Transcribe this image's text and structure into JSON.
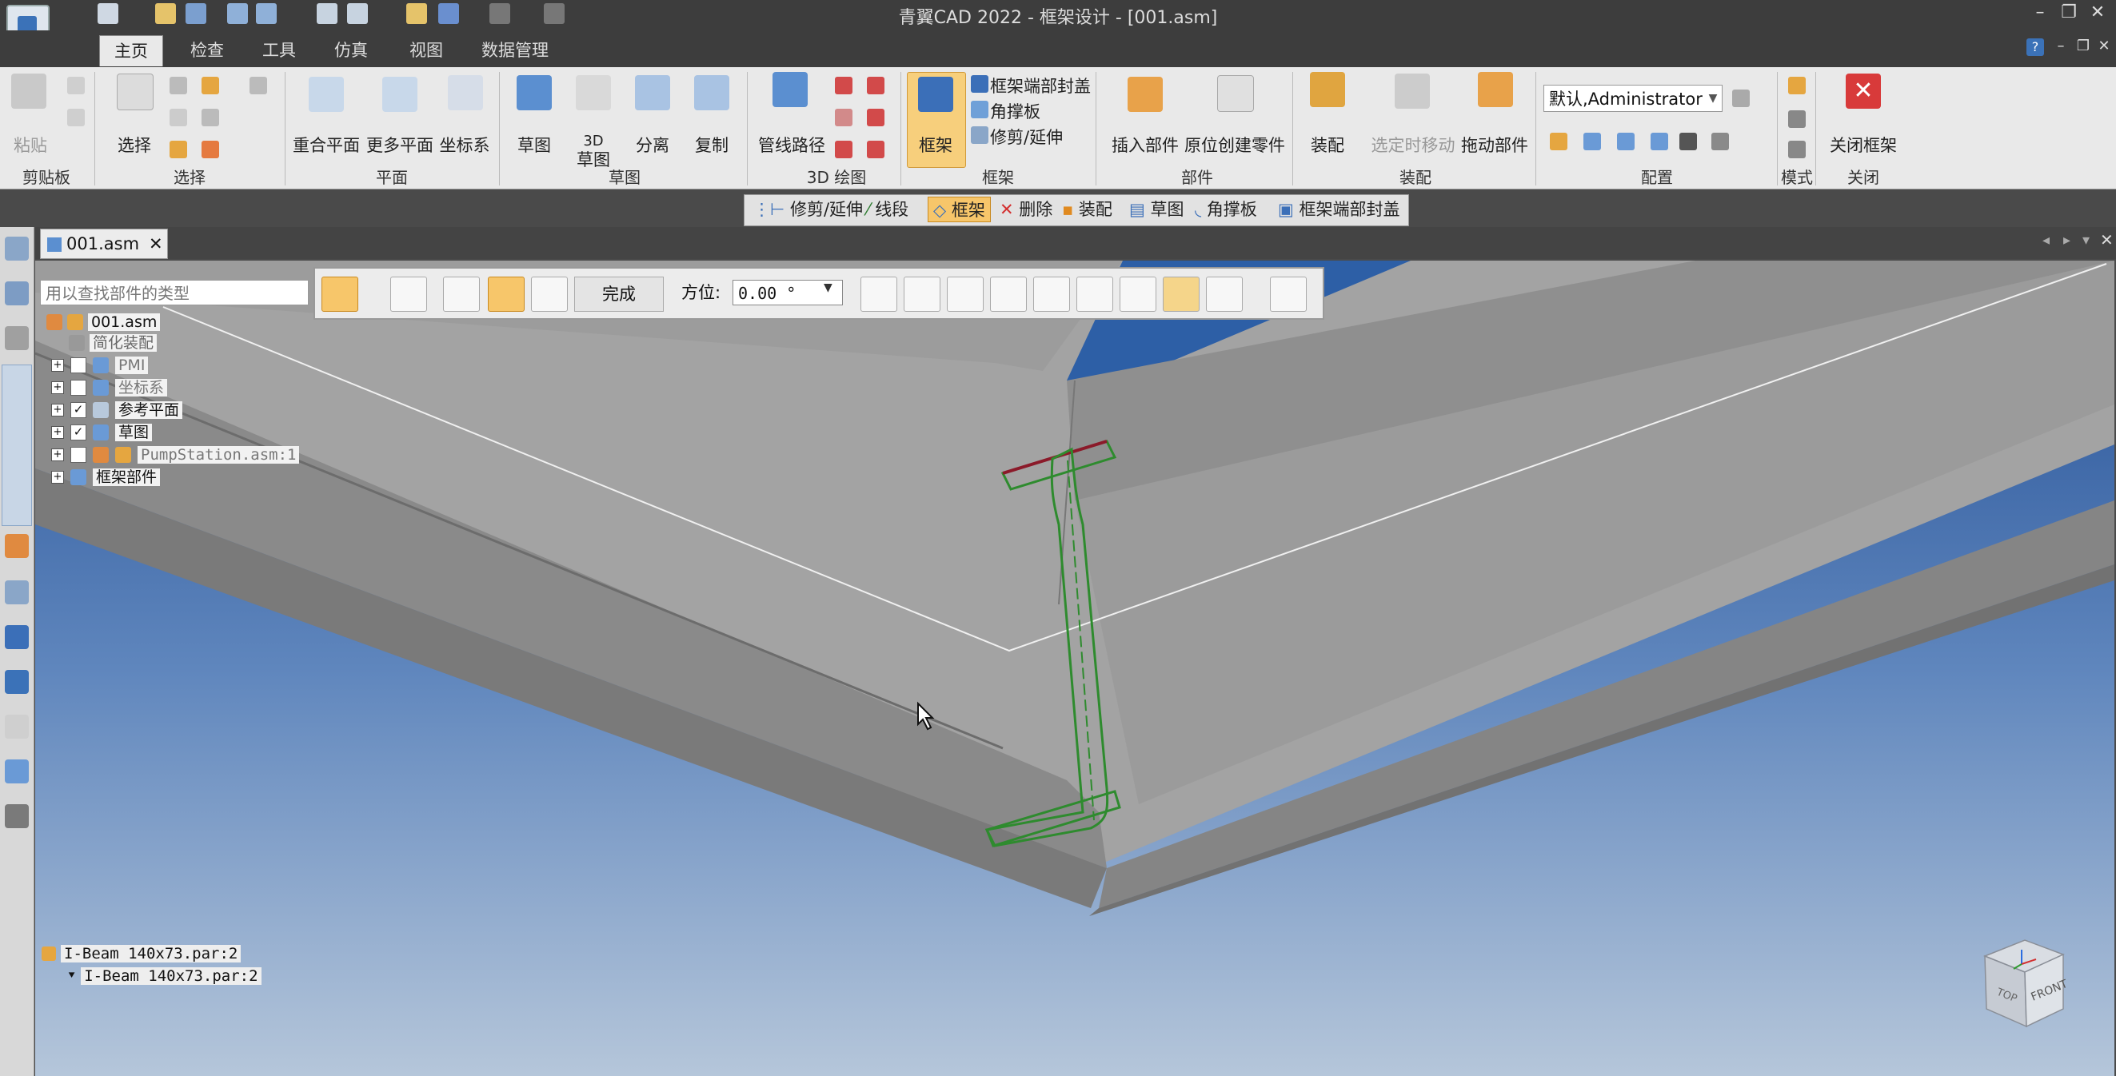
{
  "window": {
    "title": "青翼CAD 2022 - 框架设计 - [001.asm]",
    "controls": [
      "–",
      "❐",
      "✕"
    ],
    "mdi_controls": [
      "–",
      "❐",
      "✕"
    ]
  },
  "ribbon_tabs": [
    {
      "label": "主页",
      "active": true
    },
    {
      "label": "检查"
    },
    {
      "label": "工具"
    },
    {
      "label": "仿真"
    },
    {
      "label": "视图"
    },
    {
      "label": "数据管理"
    }
  ],
  "ribbon": {
    "clipboard": {
      "paste": "粘贴",
      "group": "剪贴板"
    },
    "select": {
      "select": "选择",
      "group": "选择"
    },
    "plane": {
      "coincident": "重合平面",
      "more": "更多平面",
      "coord": "坐标系",
      "group": "平面"
    },
    "sketch": {
      "sketch": "草图",
      "sketch3d_top": "3D",
      "sketch3d": "草图",
      "separate": "分离",
      "copy": "复制",
      "group": "草图"
    },
    "draw3d": {
      "pipe": "管线路径",
      "group": "3D 绘图"
    },
    "frame": {
      "frame": "框架",
      "endcap": "框架端部封盖",
      "gusset": "角撑板",
      "trim": "修剪/延伸",
      "group": "框架"
    },
    "part": {
      "insert": "插入部件",
      "inplace": "原位创建零件",
      "group": "部件"
    },
    "assembly": {
      "assemble": "装配",
      "move_selected": "选定时移动",
      "drag": "拖动部件",
      "group": "装配"
    },
    "config": {
      "combo": "默认,Administrator",
      "group": "配置"
    },
    "mode": {
      "group": "模式"
    },
    "close": {
      "close_frame": "关闭框架",
      "group": "关闭"
    }
  },
  "context_bar": [
    "修剪/延伸",
    "线段",
    "框架",
    "删除",
    "装配",
    "草图",
    "角撑板",
    "框架端部封盖"
  ],
  "document": {
    "tab": "001.asm"
  },
  "tree": {
    "search_placeholder": "用以查找部件的类型",
    "root": "001.asm",
    "simplified": "简化装配",
    "nodes": [
      {
        "label": "PMI",
        "checked": false
      },
      {
        "label": "坐标系",
        "checked": false
      },
      {
        "label": "参考平面",
        "checked": true
      },
      {
        "label": "草图",
        "checked": true
      },
      {
        "label": "PumpStation.asm:1",
        "checked": false
      }
    ],
    "frame_parts": "框架部件"
  },
  "command_bar": {
    "done": "完成",
    "orientation_label": "方位:",
    "orientation_value": "0.00 °"
  },
  "bottom_list": {
    "item": "I-Beam 140x73.par:2",
    "child": "I-Beam 140x73.par:2"
  },
  "viewcube": {
    "left_face": "TOP",
    "front_face": "FRONT"
  },
  "colors": {
    "selection": "#2e8b2e",
    "edge_highlight": "#8b1a2a",
    "sky_blue": "#2d5fa6"
  }
}
